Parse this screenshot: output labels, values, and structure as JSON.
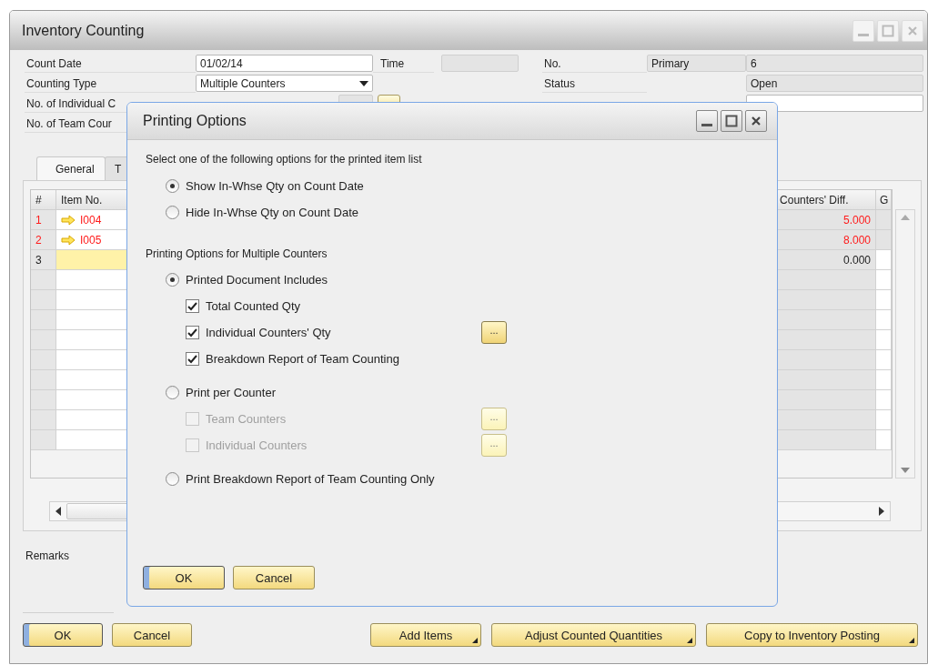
{
  "window": {
    "title": "Inventory Counting"
  },
  "header": {
    "count_date": {
      "label": "Count Date",
      "value": "01/02/14"
    },
    "counting_type": {
      "label": "Counting Type",
      "value": "Multiple Counters"
    },
    "individual_counters": {
      "label": "No. of Individual C"
    },
    "team_counters": {
      "label": "No. of Team Cour"
    },
    "time": {
      "label": "Time"
    },
    "number": {
      "label": "No.",
      "series": "Primary",
      "value": "6"
    },
    "status": {
      "label": "Status",
      "value": "Open"
    }
  },
  "tabs": [
    {
      "label": "General",
      "selected": true
    },
    {
      "label": "T",
      "selected": false
    }
  ],
  "table": {
    "columns": [
      "#",
      "Item No.",
      "Counters' Diff.",
      "G"
    ],
    "rows": [
      {
        "num": "1",
        "item": "I004",
        "diff": "5.000",
        "flagged": true,
        "selected": false
      },
      {
        "num": "2",
        "item": "I005",
        "diff": "8.000",
        "flagged": true,
        "selected": false
      },
      {
        "num": "3",
        "item": "",
        "diff": "0.000",
        "flagged": false,
        "selected": true
      }
    ]
  },
  "remarks": {
    "label": "Remarks"
  },
  "buttons": [
    {
      "label": "OK",
      "kind": "primary"
    },
    {
      "label": "Cancel",
      "kind": "plain"
    }
  ],
  "actions": [
    {
      "label": "Add Items"
    },
    {
      "label": "Adjust Counted Quantities"
    },
    {
      "label": "Copy to Inventory Posting"
    }
  ],
  "dialog": {
    "title": "Printing Options",
    "intro": "Select one of the following options for the printed item list",
    "item_list_options": [
      {
        "label": "Show In-Whse Qty on Count Date",
        "selected": true
      },
      {
        "label": "Hide In-Whse Qty on Count Date",
        "selected": false
      }
    ],
    "section": "Printing Options for Multiple Counters",
    "counter_options": [
      {
        "label": "Printed Document Includes",
        "selected": true,
        "children": [
          {
            "label": "Total Counted Qty",
            "checked": true,
            "disabled": false
          },
          {
            "label": "Individual Counters' Qty",
            "checked": true,
            "disabled": false,
            "picker": "..."
          },
          {
            "label": "Breakdown Report of Team Counting",
            "checked": true,
            "disabled": false
          }
        ]
      },
      {
        "label": "Print per Counter",
        "selected": false,
        "children": [
          {
            "label": "Team Counters",
            "checked": false,
            "disabled": true,
            "picker": "..."
          },
          {
            "label": "Individual Counters",
            "checked": false,
            "disabled": true,
            "picker": "..."
          }
        ]
      },
      {
        "label": "Print Breakdown Report of Team Counting Only",
        "selected": false
      }
    ],
    "buttons": [
      {
        "label": "OK",
        "kind": "primary"
      },
      {
        "label": "Cancel",
        "kind": "plain"
      }
    ]
  }
}
